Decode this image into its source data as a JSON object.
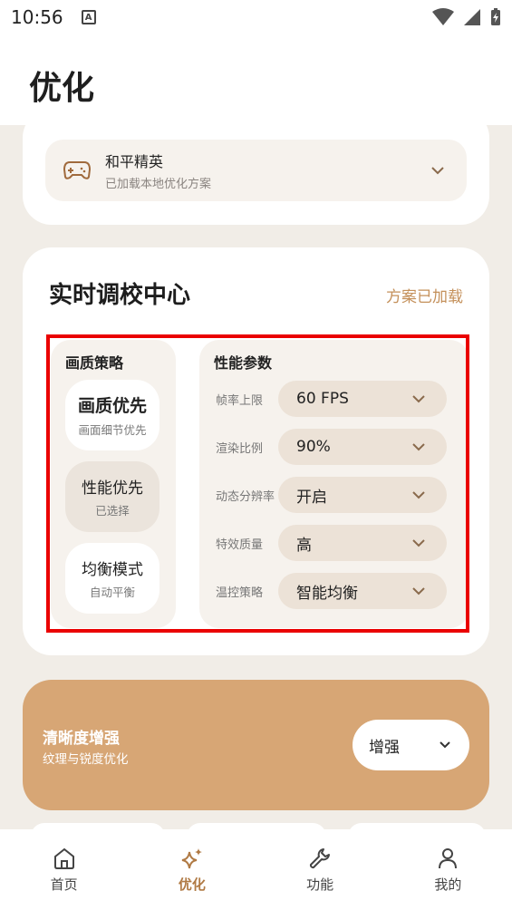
{
  "status_bar": {
    "time": "10:56",
    "notification_icon": "A"
  },
  "header": {
    "title": "优化"
  },
  "game_selector": {
    "name": "和平精英",
    "subtitle": "已加载本地优化方案"
  },
  "tuning": {
    "title": "实时调校中心",
    "status": "方案已加载",
    "quality_panel": {
      "label": "画质策略",
      "modes": [
        {
          "name": "画质优先",
          "sub": "画面细节优先"
        },
        {
          "name": "性能优先",
          "sub": "已选择"
        },
        {
          "name": "均衡模式",
          "sub": "自动平衡"
        }
      ]
    },
    "perf_panel": {
      "label": "性能参数",
      "params": [
        {
          "label": "帧率上限",
          "value": "60 FPS"
        },
        {
          "label": "渲染比例",
          "value": "90%"
        },
        {
          "label": "动态分辨率",
          "value": "开启"
        },
        {
          "label": "特效质量",
          "value": "高"
        },
        {
          "label": "温控策略",
          "value": "智能均衡"
        }
      ]
    }
  },
  "enhance": {
    "title": "清晰度增强",
    "subtitle": "纹理与锐度优化",
    "value": "增强"
  },
  "tabs": [
    {
      "label": "首页",
      "icon": "home-icon"
    },
    {
      "label": "优化",
      "icon": "sparkle-icon"
    },
    {
      "label": "功能",
      "icon": "wrench-icon"
    },
    {
      "label": "我的",
      "icon": "person-icon"
    }
  ],
  "colors": {
    "accent": "#b07a44",
    "enhance_bg": "#d7a675",
    "highlight": "#ea0000",
    "page_bg": "#f1ede7"
  }
}
